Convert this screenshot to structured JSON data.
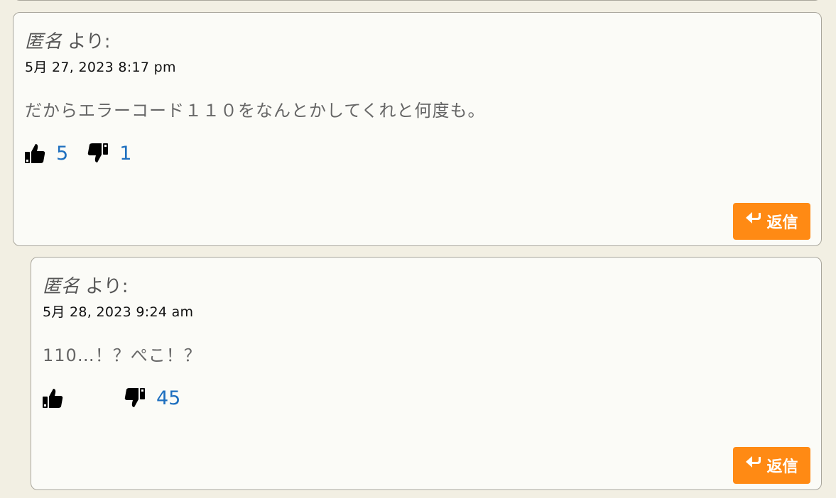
{
  "comments": [
    {
      "author_name": "匿名",
      "author_suffix": " より:",
      "date": "5月 27, 2023 8:17 pm",
      "text": "だからエラーコード１１０をなんとかしてくれと何度も。",
      "likes": "5",
      "dislikes": "1",
      "reply_label": "返信"
    },
    {
      "author_name": "匿名",
      "author_suffix": " より:",
      "date": "5月 28, 2023 9:24 am",
      "text": "110…！？ぺこ！？",
      "likes": "",
      "dislikes": "45",
      "reply_label": "返信"
    }
  ],
  "colors": {
    "accent": "#ff8a14",
    "vote_count": "#1e6fbf",
    "background": "#f2efe3",
    "card": "#fbfbf7"
  },
  "icons": {
    "like": "thumbs-up-icon",
    "dislike": "thumbs-down-icon",
    "reply": "reply-arrow-icon"
  }
}
